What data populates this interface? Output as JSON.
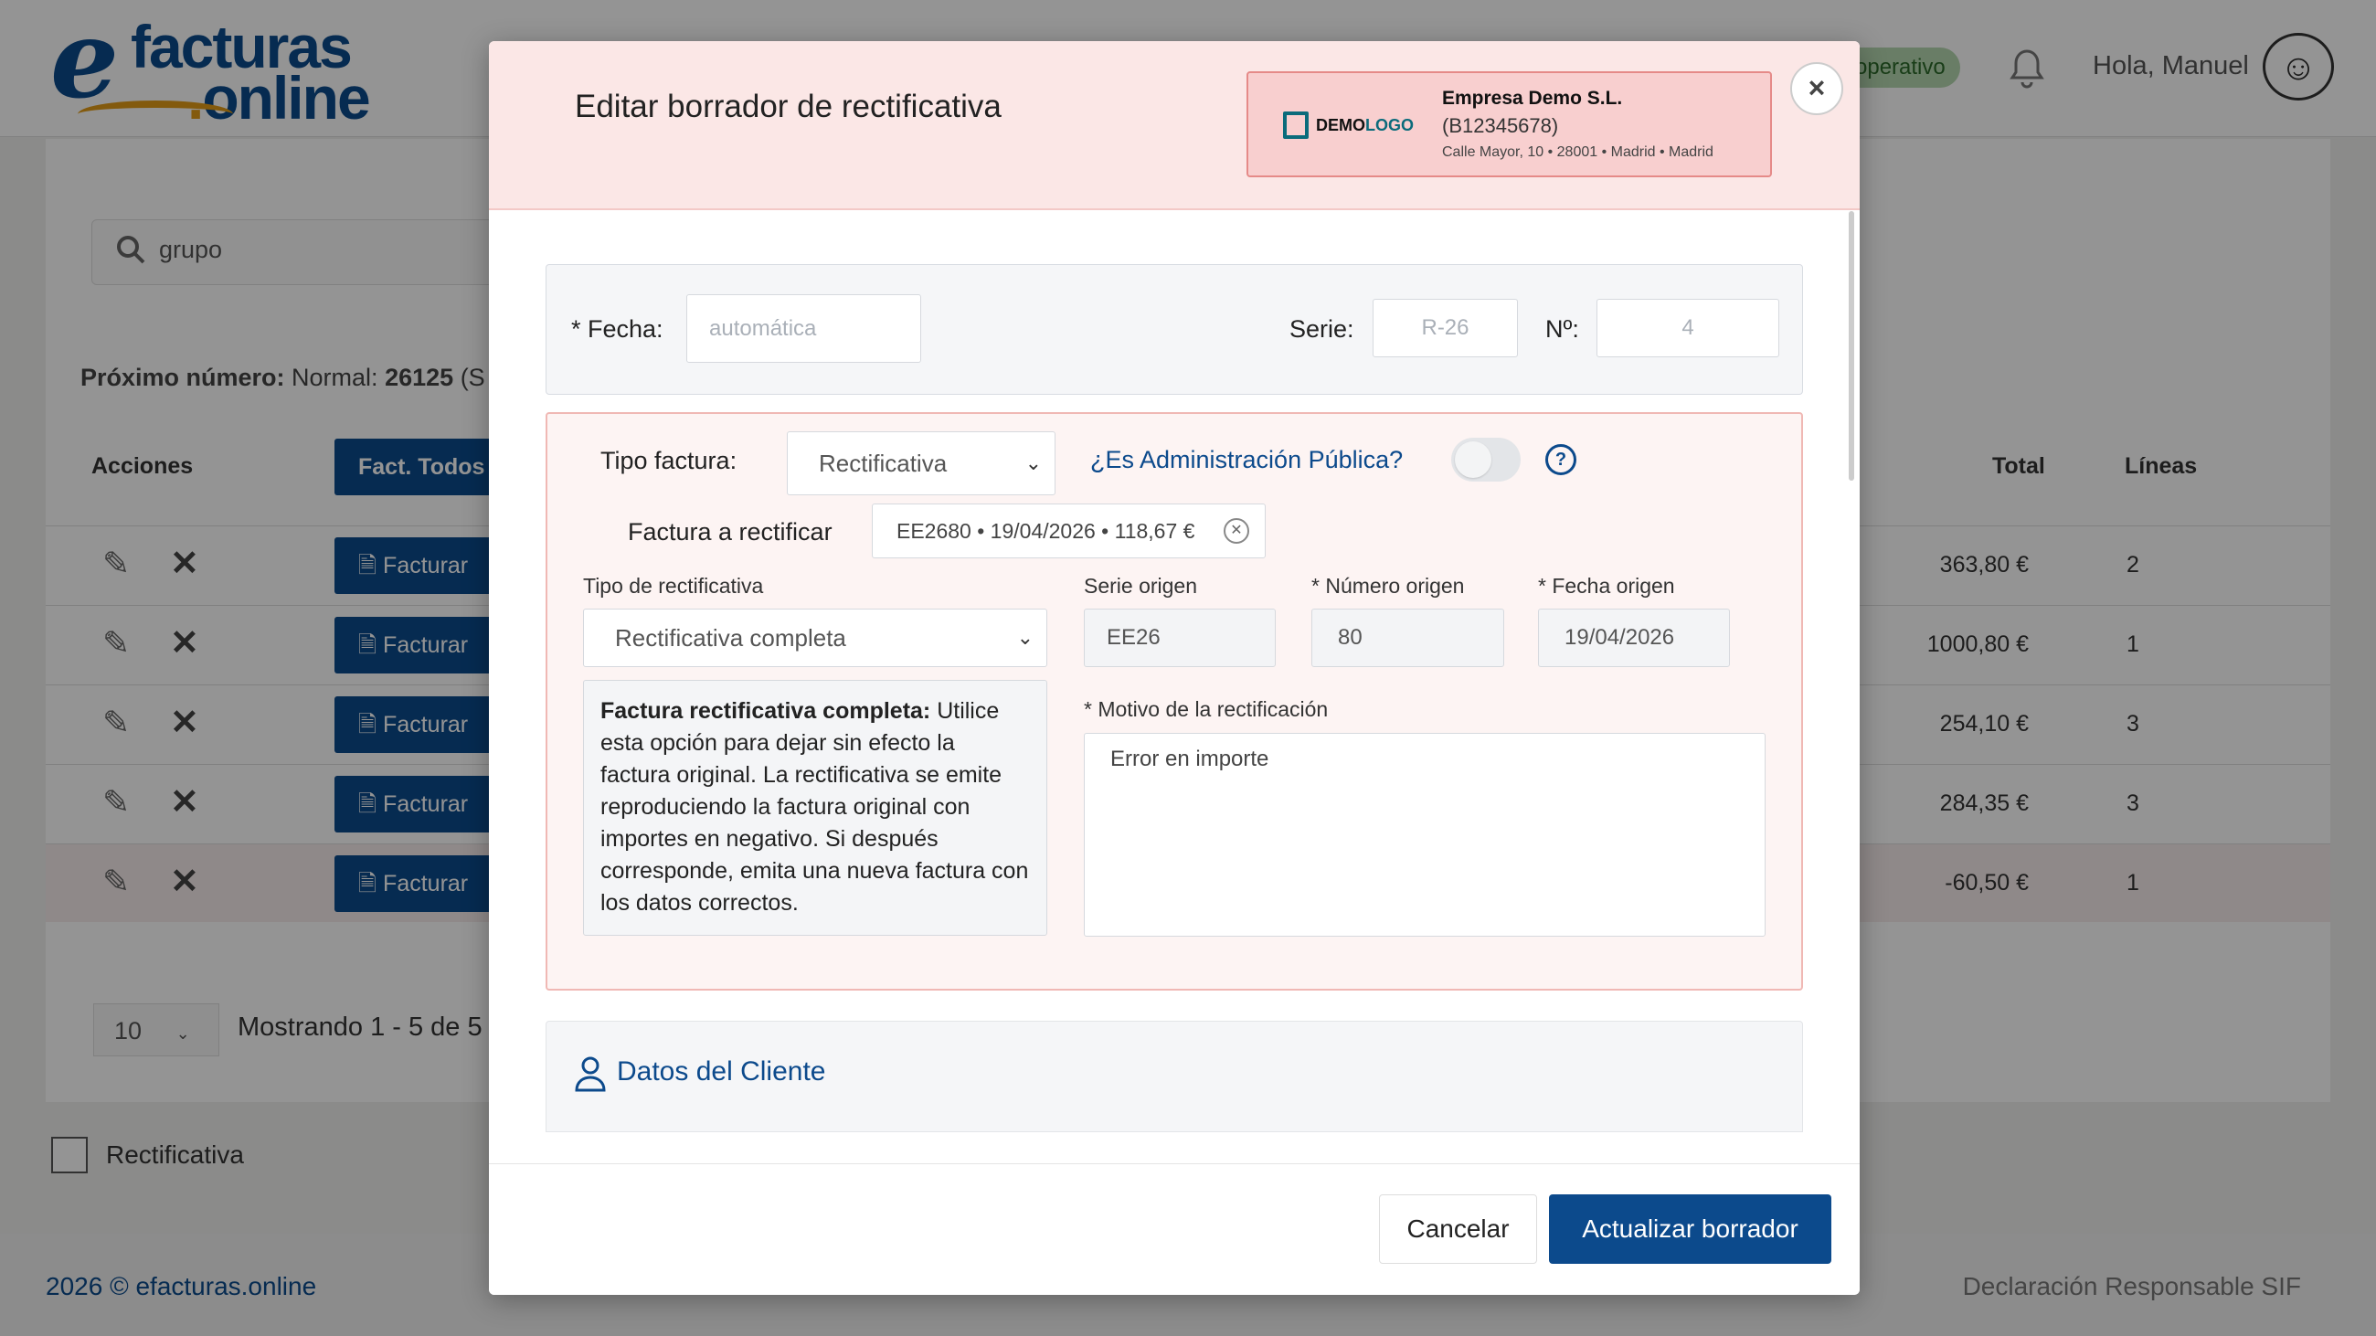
{
  "app": {
    "logo_e": "e",
    "logo_line1": "facturas",
    "logo_dot": ".",
    "logo_line2": "online",
    "status": "operativo",
    "greeting": "Hola, Manuel"
  },
  "list": {
    "search_value": "grupo",
    "next_number_label": "Próximo número:",
    "next_number_type": "Normal:",
    "next_number_value": "26125",
    "next_number_rest": "(S",
    "col_actions": "Acciones",
    "fact_all_button": "Fact. Todos",
    "col_total": "Total",
    "col_lines": "Líneas",
    "rows": [
      {
        "action": "Facturar",
        "total": "363,80 €",
        "lines": "2"
      },
      {
        "action": "Facturar",
        "total": "1000,80 €",
        "lines": "1"
      },
      {
        "action": "Facturar",
        "total": "254,10 €",
        "lines": "3"
      },
      {
        "action": "Facturar",
        "total": "284,35 €",
        "lines": "3"
      },
      {
        "action": "Facturar",
        "total": "-60,50 €",
        "lines": "1"
      }
    ],
    "per_page": "10",
    "showing": "Mostrando 1 - 5 de 5",
    "rectificativa_filter": "Rectificativa"
  },
  "footer": {
    "copyright": "2026 © efacturas.online",
    "declaration": "Declaración Responsable SIF"
  },
  "modal": {
    "title": "Editar borrador de rectificativa",
    "company": {
      "logo_a": "DEMO",
      "logo_b": "LOGO",
      "name": "Empresa Demo S.L.",
      "cif": "(B12345678)",
      "address": "Calle Mayor, 10 • 28001 • Madrid • Madrid"
    },
    "close": "×",
    "fecha_label": "* Fecha:",
    "fecha_placeholder": "automática",
    "serie_label": "Serie:",
    "serie_value": "R-26",
    "numero_label": "Nº:",
    "numero_value": "4",
    "tipo_factura_label": "Tipo factura:",
    "tipo_factura_value": "Rectificativa",
    "admin_publica_label": "¿Es Administración Pública?",
    "admin_publica_on": false,
    "help": "?",
    "factura_rectificar_label": "Factura a rectificar",
    "factura_rectificar_value": "EE2680 • 19/04/2026 • 118,67 €",
    "tipo_rect_label": "Tipo de rectificativa",
    "tipo_rect_value": "Rectificativa completa",
    "serie_origen_label": "Serie origen",
    "serie_origen_value": "EE26",
    "numero_origen_label": "* Número origen",
    "numero_origen_value": "80",
    "fecha_origen_label": "* Fecha origen",
    "fecha_origen_value": "19/04/2026",
    "info_title": "Factura rectificativa completa:",
    "info_text": " Utilice esta opción para dejar sin efecto la factura original. La rectificativa se emite reproduciendo la factura original con importes en negativo. Si después corresponde, emita una nueva factura con los datos correctos.",
    "motivo_label": "* Motivo de la rectificación",
    "motivo_value": "Error en importe",
    "cliente_title": "Datos del Cliente",
    "cancel": "Cancelar",
    "update": "Actualizar borrador"
  },
  "colors": {
    "brand_blue": "#0c4a8c",
    "brand_orange": "#e29b17",
    "header_pink": "#fbe7e6",
    "section_border": "#f0b8b4"
  }
}
